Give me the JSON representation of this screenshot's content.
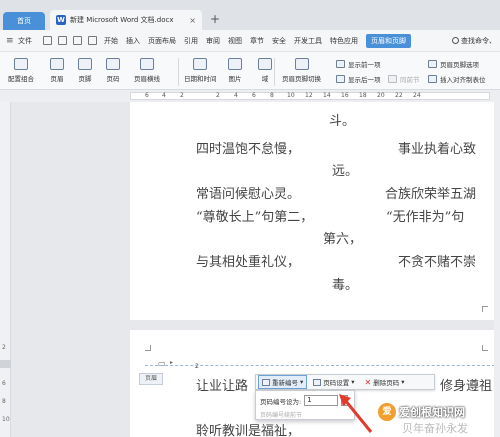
{
  "tabs": {
    "home": "首页",
    "doc": "新建 Microsoft Word 文档.docx",
    "doc_icon": "W",
    "close": "×",
    "new_tab": "+"
  },
  "menu": {
    "file": "文件",
    "items": [
      "开始",
      "插入",
      "页面布局",
      "引用",
      "审阅",
      "视图",
      "章节",
      "安全",
      "开发工具",
      "特色应用"
    ],
    "active": "页眉和页脚",
    "search": "查找命令、"
  },
  "ribbon": {
    "large": [
      "配置组合",
      "页眉",
      "页脚",
      "页码",
      "页眉横线",
      "日期和时间",
      "图片",
      "域",
      "页眉页脚切换"
    ],
    "small": {
      "show_prev": "显示前一项",
      "show_next": "显示后一项",
      "same_as_prev": "同前节",
      "page_options": "页眉页脚选项",
      "insert_tab": "插入对齐制表位"
    }
  },
  "ruler": {
    "numbers": [
      "6",
      "4",
      "2",
      "2",
      "4",
      "6",
      "8",
      "10",
      "12",
      "14",
      "16",
      "18",
      "20",
      "22",
      "24"
    ]
  },
  "vruler": {
    "numbers": [
      "2",
      "4",
      "6",
      "8",
      "10"
    ]
  },
  "poem": {
    "l1": "斗。",
    "l2a": "四时温饱不怠慢，",
    "l2b": "事业执着心致",
    "l3": "远。",
    "l4a": "常语问候慰心灵。",
    "l4b": "合族欣荣举五湖",
    "l5a": "“尊敬长上”句第二，",
    "l5b": "“无作非为”句",
    "l6": "第六，",
    "l7a": "与其相处重礼仪，",
    "l7b": "不贪不赌不崇",
    "l8": "毒。",
    "p2a": "让业让路",
    "p2b": "修身遵祖",
    "p2c": "聆听教训是福祉，",
    "p2d": "贝年奋孙永发"
  },
  "header": {
    "tag": "页眉",
    "page_number": "2",
    "small_label": "▸"
  },
  "page_number_toolbar": {
    "renumber": "重新编号",
    "settings": "页码设置",
    "delete": "删除页码",
    "set_label": "页码编号设为:",
    "value": "1",
    "continue": "页码编号续前节"
  },
  "watermark": {
    "logo": "爱",
    "text": "爱创根知识网"
  },
  "colors": {
    "accent": "#4a90d9",
    "arrow": "#e23a2c"
  }
}
